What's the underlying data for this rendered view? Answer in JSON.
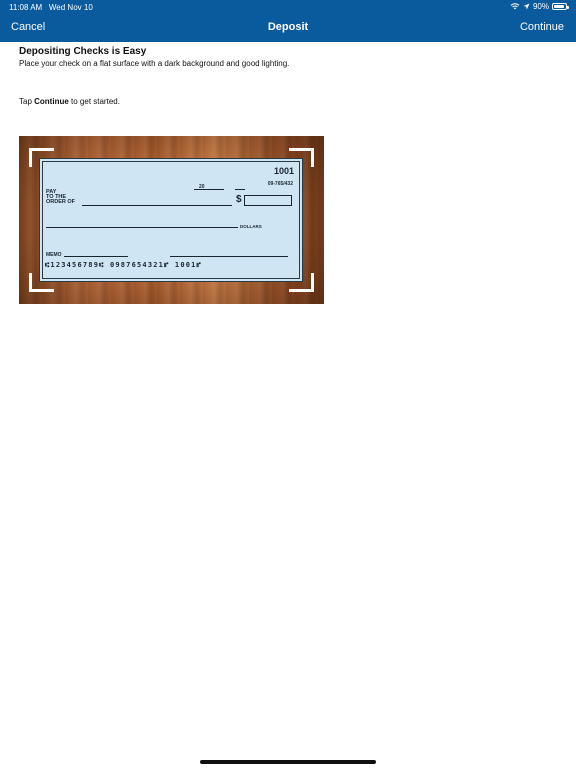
{
  "status_bar": {
    "time": "11:08 AM",
    "date": "Wed Nov 10",
    "battery": "90%",
    "battery_level": 0.9
  },
  "nav": {
    "left_label": "Cancel",
    "title": "Deposit",
    "right_label": "Continue"
  },
  "content": {
    "heading": "Depositing Checks is Easy",
    "subtext": "Place your check on a flat surface with a dark background and good lighting.",
    "tap_prefix": "Tap ",
    "tap_bold": "Continue",
    "tap_suffix": " to get started."
  },
  "check": {
    "number": "1001",
    "routing": "09-765/432",
    "date_suffix": "20",
    "pay_line1": "PAY",
    "pay_line2": "TO THE",
    "pay_line3": "ORDER OF",
    "dollar_sign": "$",
    "dollars_label": "DOLLARS",
    "memo_label": "MEMO",
    "micr": "⑆123456789⑆  0987654321⑈  1001⑈"
  },
  "colors": {
    "nav_bar": "#0a5a9e",
    "check_paper": "#cfe5f3",
    "wood": "#a55b2d"
  },
  "icons": {
    "wifi": "wifi-icon",
    "location": "location-arrow-icon",
    "battery": "battery-icon"
  }
}
